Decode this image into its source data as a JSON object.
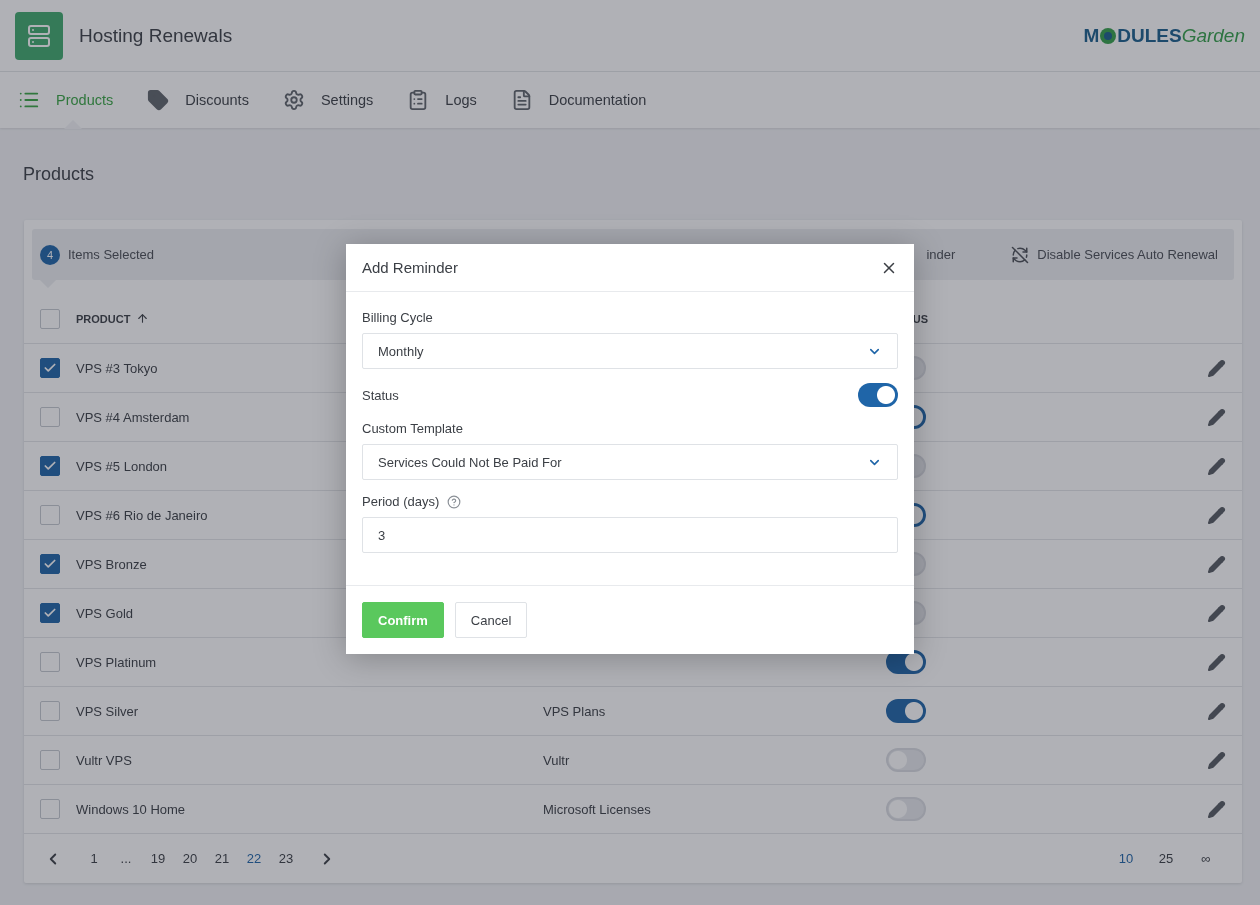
{
  "app": {
    "title": "Hosting Renewals",
    "logo": {
      "left": "M",
      "middle": "DULES",
      "right": "Garden"
    }
  },
  "nav": [
    {
      "label": "Products",
      "kind": "table",
      "selected": true
    },
    {
      "label": "Discounts",
      "kind": "tag",
      "selected": false
    },
    {
      "label": "Settings",
      "kind": "gear",
      "selected": false
    },
    {
      "label": "Logs",
      "kind": "clipboard",
      "selected": false
    },
    {
      "label": "Documentation",
      "kind": "file",
      "selected": false
    }
  ],
  "page_title": "Products",
  "selection_bar": {
    "count": "4",
    "label": "Items Selected",
    "actions": [
      {
        "label": "inder",
        "kind": "text"
      },
      {
        "label": "Disable Services Auto Renewal",
        "kind": "sync-off"
      }
    ]
  },
  "table": {
    "all_checked": false,
    "columns": [
      {
        "label": "PRODUCT",
        "sorted": true
      },
      {
        "label": "US",
        "sorted": false
      }
    ],
    "rows": [
      {
        "product": "VPS #3 Tokyo",
        "checked": true,
        "on": false
      },
      {
        "product": "VPS #4 Amsterdam",
        "checked": false,
        "on": true
      },
      {
        "product": "VPS #5 London",
        "checked": true,
        "on": false
      },
      {
        "product": "VPS #6 Rio de Janeiro",
        "checked": false,
        "on": true
      },
      {
        "product": "VPS Bronze",
        "checked": true,
        "on": false
      },
      {
        "product": "VPS Gold",
        "checked": true,
        "on": false
      },
      {
        "product": "VPS Platinum",
        "checked": false,
        "on": true
      },
      {
        "product": "VPS Silver",
        "group": "VPS Plans",
        "checked": false,
        "on": true
      },
      {
        "product": "Vultr VPS",
        "group": "Vultr",
        "checked": false,
        "on": false
      },
      {
        "product": "Windows 10 Home",
        "group": "Microsoft Licenses",
        "checked": false,
        "on": false
      }
    ]
  },
  "pagination": {
    "pages": [
      {
        "label": "1",
        "selected": false
      },
      {
        "label": "...",
        "selected": false
      },
      {
        "label": "19",
        "selected": false
      },
      {
        "label": "20",
        "selected": false
      },
      {
        "label": "21",
        "selected": false
      },
      {
        "label": "22",
        "selected": true
      },
      {
        "label": "23",
        "selected": false
      }
    ],
    "per_page": [
      {
        "label": "10",
        "selected": true
      },
      {
        "label": "25",
        "selected": false
      },
      {
        "label": "∞",
        "selected": false
      }
    ]
  },
  "modal": {
    "title": "Add Reminder",
    "fields": [
      {
        "kind": "select",
        "label": "Billing Cycle",
        "value": "Monthly"
      },
      {
        "kind": "switch",
        "label": "Status",
        "on": true
      },
      {
        "kind": "select",
        "label": "Custom Template",
        "value": "Services Could Not Be Paid For"
      },
      {
        "kind": "input",
        "label": "Period (days)",
        "help": true,
        "value": "3"
      }
    ],
    "buttons": [
      {
        "label": "Confirm",
        "kind": "primary"
      },
      {
        "label": "Cancel",
        "kind": "secondary"
      }
    ]
  }
}
